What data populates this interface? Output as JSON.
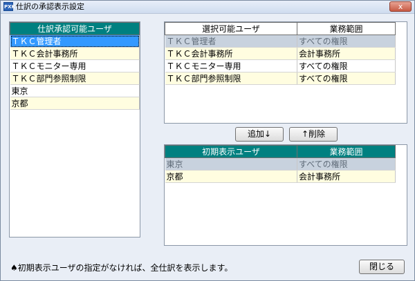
{
  "window": {
    "app_icon_label": "PXK",
    "title": "仕訳の承認表示設定",
    "close_label": "x"
  },
  "left_panel": {
    "header": "仕訳承認可能ユーザ",
    "rows": [
      "ＴＫＣ管理者",
      "ＴＫＣ会計事務所",
      "ＴＫＣモニター専用",
      "ＴＫＣ部門参照制限",
      "東京",
      "京都"
    ]
  },
  "selectable_panel": {
    "col1": "選択可能ユーザ",
    "col2": "業務範囲",
    "rows": [
      {
        "user": "ＴＫＣ管理者",
        "scope": "すべての権限"
      },
      {
        "user": "ＴＫＣ会計事務所",
        "scope": "会計事務所"
      },
      {
        "user": "ＴＫＣモニター専用",
        "scope": "すべての権限"
      },
      {
        "user": "ＴＫＣ部門参照制限",
        "scope": "すべての権限"
      }
    ]
  },
  "buttons": {
    "add": "追加↓",
    "delete": "↑削除",
    "close": "閉じる"
  },
  "initial_panel": {
    "col1": "初期表示ユーザ",
    "col2": "業務範囲",
    "rows": [
      {
        "user": "東京",
        "scope": "すべての権限"
      },
      {
        "user": "京都",
        "scope": "会計事務所"
      }
    ]
  },
  "note": "♠初期表示ユーザの指定がなければ、全仕訳を表示します。"
}
